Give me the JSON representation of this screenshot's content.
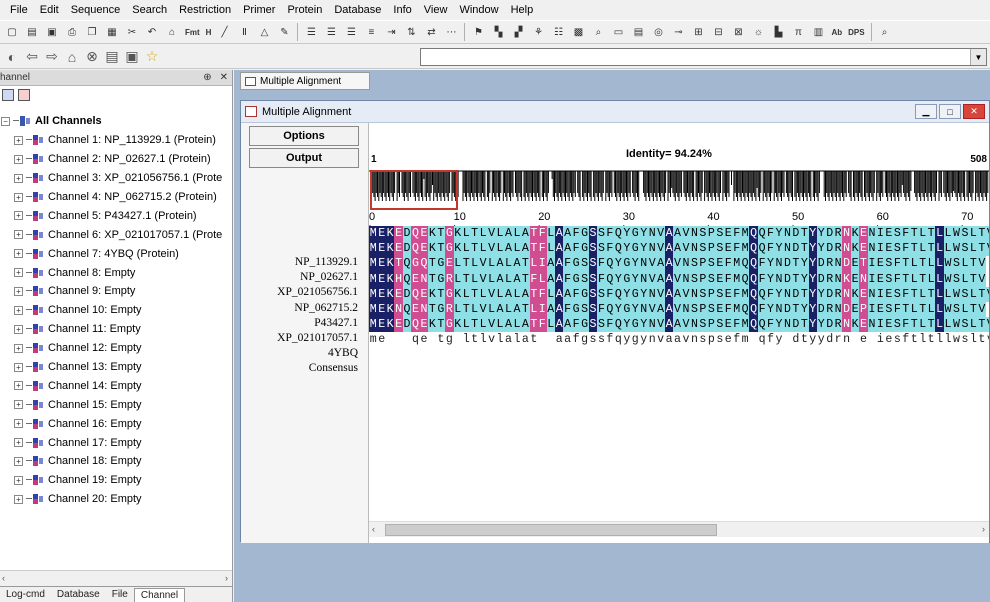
{
  "menu": [
    "File",
    "Edit",
    "Sequence",
    "Search",
    "Restriction",
    "Primer",
    "Protein",
    "Database",
    "Info",
    "View",
    "Window",
    "Help"
  ],
  "toolbar": {
    "fmt_label": "Fmt",
    "h_label": "H",
    "ab_label": "Ab",
    "dps_label": "DPS"
  },
  "left_pane": {
    "title": "hannel",
    "root_label": "All Channels",
    "channels": [
      "Channel 1: NP_113929.1 (Protein)",
      "Channel 2: NP_02627.1 (Protein)",
      "Channel 3: XP_021056756.1 (Prote",
      "Channel 4: NP_062715.2 (Protein)",
      "Channel 5: P43427.1 (Protein)",
      "Channel 6: XP_021017057.1 (Prote",
      "Channel 7: 4YBQ (Protein)",
      "Channel 8: Empty",
      "Channel 9: Empty",
      "Channel 10: Empty",
      "Channel 11: Empty",
      "Channel 12: Empty",
      "Channel 13: Empty",
      "Channel 14: Empty",
      "Channel 15: Empty",
      "Channel 16: Empty",
      "Channel 17: Empty",
      "Channel 18: Empty",
      "Channel 19: Empty",
      "Channel 20: Empty"
    ],
    "tabs": [
      "Log-cmd",
      "Database",
      "File",
      "Channel"
    ]
  },
  "doc_tab_label": "Multiple Alignment",
  "window": {
    "title": "Multiple Alignment",
    "options_label": "Options",
    "output_label": "Output",
    "identity_text": "Identity= 94.24%",
    "start_num": "1",
    "end_num": "508",
    "ruler": [
      "0",
      "10",
      "20",
      "30",
      "40",
      "50",
      "60",
      "70"
    ],
    "names": [
      "NP_113929.1",
      "NP_02627.1",
      "XP_021056756.1",
      "NP_062715.2",
      "P43427.1",
      "XP_021017057.1",
      "4YBQ",
      "Consensus"
    ],
    "sequences": [
      "MEKEDQEKTGKLTLVLALATFLAAFGSSFQYGYNVAAVNSPSEFMQQFYNDTYYDRNKENIESFTLTLLWSLTV",
      "MEKEDQEKTGKLTLVLALATFLAAFGSSFQYGYNVAAVNSPSEFMQQFYNDTYYDRNKENIESFTLTLLWSLTV",
      "MEKTQGQTGELTLVLALATLIAAFGSSFQYGYNVAAVNSPSEFMQQFYNDTYYDRNDETIESFTLTLLWSLTV",
      "MEKHQENTGRLTLVLALATFLAAFGSSFQYGYNVAAVNSPSEFMQQFYNDTYYDRNKENIESFTLTLLWSLTV",
      "MEKEDQEKTGKLTLVLALATFLAAFGSSFQYGYNVAAVNSPSEFMQQFYNDTYYDRNKENIESFTLTLLWSLTV",
      "MEKNQENTGRLTLVLALATLIAAFGSSFQYGYNVAAVNSPSEFMQQFYNDTYYDRNDEPIESFTLTLLWSLTV",
      "MEKEDQEKTGKLTLVLALATFLAAFGSSFQYGYNVAAVNSPSEFMQQFYNDTYYDRNKENIESFTLTLLWSLTV"
    ],
    "consensus": "me   qe tg ltlvlalat  aafgssfqygynvaavnspsefm qfy dtyydrn e iesftltllwsltv"
  },
  "colors": {
    "identical": "#1a2066",
    "similar": "#8fe0e6",
    "variable": "#d04d91",
    "selection_box": "#c0392b"
  }
}
